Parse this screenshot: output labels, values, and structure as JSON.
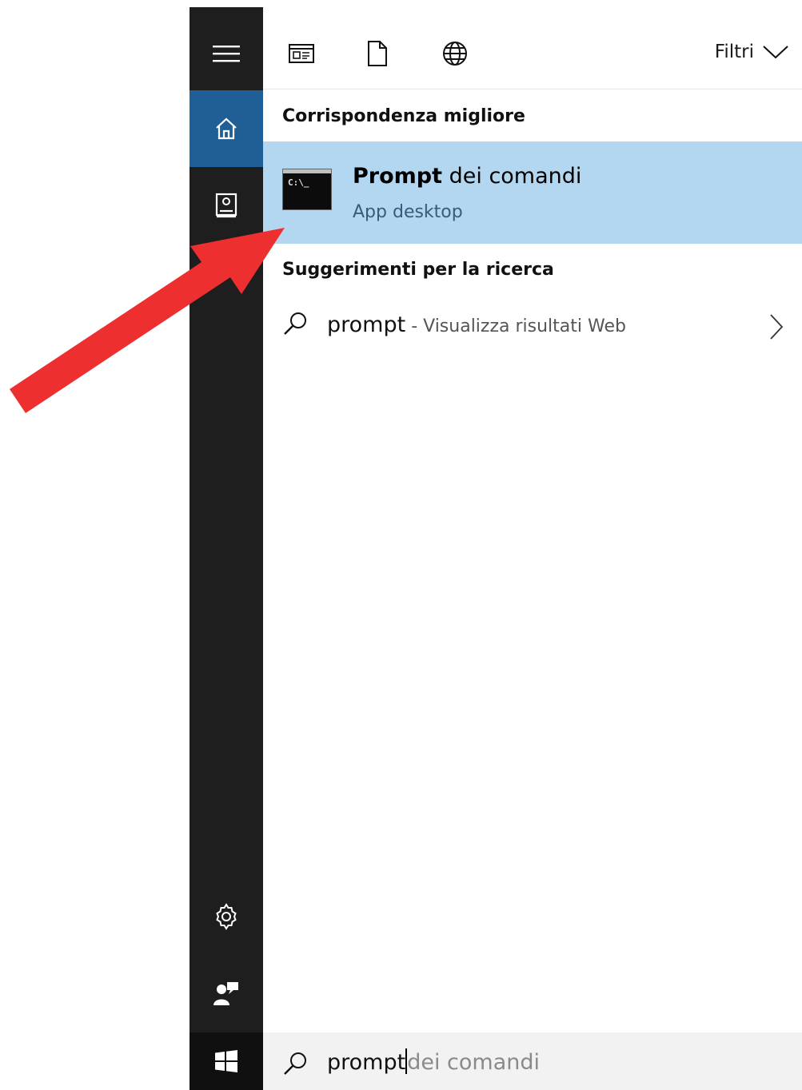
{
  "sidebar": {
    "items": [
      {
        "icon": "hamburger-menu-icon"
      },
      {
        "icon": "home-icon",
        "active": true
      },
      {
        "icon": "notebook-icon"
      }
    ],
    "bottom": [
      {
        "icon": "gear-icon"
      },
      {
        "icon": "feedback-icon"
      }
    ],
    "start_icon": "windows-logo-icon"
  },
  "toolbar": {
    "icons": [
      "apps-filter-icon",
      "documents-filter-icon",
      "web-filter-icon"
    ],
    "filters_label": "Filtri"
  },
  "best_match": {
    "section_title": "Corrispondenza migliore",
    "title_bold": "Prompt",
    "title_rest": " dei comandi",
    "subtitle": "App desktop",
    "icon_text": "C:\\_"
  },
  "suggestions": {
    "section_title": "Suggerimenti per la ricerca",
    "items": [
      {
        "query": "prompt",
        "hint": " - Visualizza risultati Web"
      }
    ]
  },
  "search": {
    "typed": "prompt",
    "completion": "dei comandi"
  },
  "colors": {
    "sidebar_bg": "#1e1e1e",
    "active_accent": "#1f5f95",
    "selection_bg": "#b3d7f0",
    "arrow": "#ee2f2f"
  }
}
